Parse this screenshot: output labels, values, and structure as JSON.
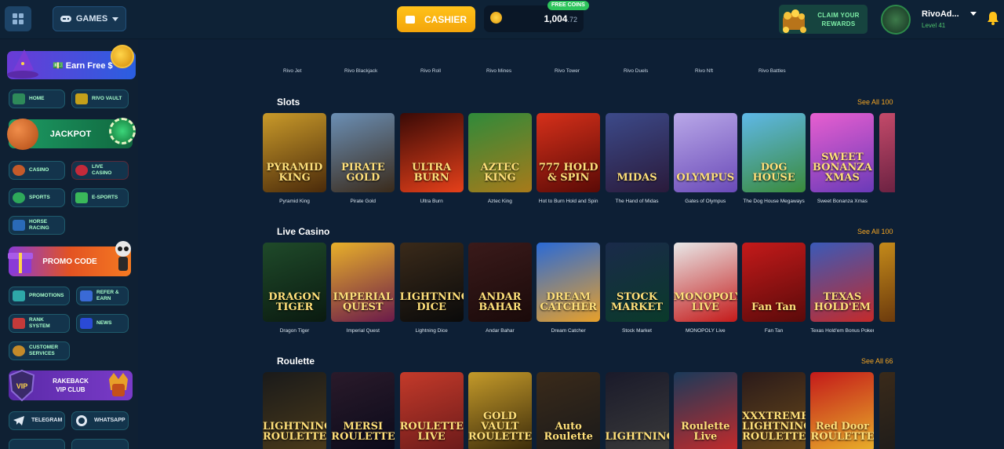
{
  "topbar": {
    "games_label": "GAMES",
    "cashier_label": "CASHIER",
    "free_coins_label": "FREE COINS",
    "balance_main": "1,004",
    "balance_decimal": ".72",
    "claim_label_line1": "CLAIM YOUR",
    "claim_label_line2": "REWARDS",
    "username": "RivoAd...",
    "level": "Level 41"
  },
  "sidebar": {
    "earn_label": "💵 Earn Free $",
    "home": "HOME",
    "rivo_vault": "RIVO VAULT",
    "jackpot": "JACKPOT",
    "casino": "CASINO",
    "live_casino_1": "LIVE",
    "live_casino_2": "CASINO",
    "sports": "SPORTS",
    "esports": "E-SPORTS",
    "horse_1": "HORSE",
    "horse_2": "RACING",
    "promo_code": "PROMO CODE",
    "promotions": "PROMOTIONS",
    "refer_1": "REFER &",
    "refer_2": "EARN",
    "rank_1": "RANK",
    "rank_2": "SYSTEM",
    "news": "NEWS",
    "cs_1": "CUSTOMER",
    "cs_2": "SERVICES",
    "vip_1": "RAKEBACK",
    "vip_2": "VIP CLUB",
    "telegram": "Telegram",
    "whatsapp": "WhatsAPP"
  },
  "top_links": [
    "Rivo Jet",
    "Rivo Blackjack",
    "Rivo Roll",
    "Rivo Mines",
    "Rivo Tower",
    "Rivo Duels",
    "Rivo Nft",
    "Rivo Battles"
  ],
  "sections": {
    "slots": {
      "title": "Slots",
      "see_all": "See All 100",
      "games": [
        {
          "name": "Pyramid King",
          "art": "PYRAMID KING",
          "c1": "#c99a2a",
          "c2": "#4a2a0a"
        },
        {
          "name": "Pirate Gold",
          "art": "PIRATE GOLD",
          "c1": "#6b8fb5",
          "c2": "#3a2a1a"
        },
        {
          "name": "Ultra Burn",
          "art": "ULTRA BURN",
          "c1": "#3a0a06",
          "c2": "#e6401a"
        },
        {
          "name": "Aztec King",
          "art": "AZTEC KING",
          "c1": "#2f8a3a",
          "c2": "#a87a1a"
        },
        {
          "name": "Hot to Burn Hold and Spin",
          "art": "777 HOLD & SPIN",
          "c1": "#d6301a",
          "c2": "#5a0a06"
        },
        {
          "name": "The Hand of Midas",
          "art": "MIDAS",
          "c1": "#3c4a8a",
          "c2": "#2a1a3a"
        },
        {
          "name": "Gates of Olympus",
          "art": "OLYMPUS",
          "c1": "#b9a8e8",
          "c2": "#6a4ab8"
        },
        {
          "name": "The Dog House Megaways",
          "art": "DOG HOUSE",
          "c1": "#5fb8e8",
          "c2": "#3a8a3a"
        },
        {
          "name": "Sweet Bonanza Xmas",
          "art": "SWEET BONANZA XMAS",
          "c1": "#e85fd0",
          "c2": "#6a3ab8"
        },
        {
          "name": "Th",
          "art": "",
          "c1": "#c44a6a",
          "c2": "#5a1a3a"
        }
      ]
    },
    "live": {
      "title": "Live Casino",
      "see_all": "See All 100",
      "games": [
        {
          "name": "Dragon Tiger",
          "art": "DRAGON TIGER",
          "c1": "#1f4a2a",
          "c2": "#0a1a10"
        },
        {
          "name": "Imperial Quest",
          "art": "IMPERIAL QUEST",
          "c1": "#e8b02a",
          "c2": "#6a1a4a"
        },
        {
          "name": "Lightning Dice",
          "art": "LIGHTNING DICE",
          "c1": "#3a2a1a",
          "c2": "#0a0a0a"
        },
        {
          "name": "Andar Bahar",
          "art": "ANDAR BAHAR",
          "c1": "#3a1a1a",
          "c2": "#1a0a0a"
        },
        {
          "name": "Dream Catcher",
          "art": "DREAM CATCHER",
          "c1": "#2a6ad6",
          "c2": "#e8a02a"
        },
        {
          "name": "Stock Market",
          "art": "STOCK MARKET",
          "c1": "#1a2a4a",
          "c2": "#0a3a2a"
        },
        {
          "name": "MONOPOLY Live",
          "art": "MONOPOLY LIVE",
          "c1": "#e8e8e8",
          "c2": "#c41a1a"
        },
        {
          "name": "Fan Tan",
          "art": "Fan Tan",
          "c1": "#c41a1a",
          "c2": "#5a0a0a"
        },
        {
          "name": "Texas Hold'em Bonus Poker",
          "art": "TEXAS HOLD'EM",
          "c1": "#3a5ab8",
          "c2": "#c42a2a"
        },
        {
          "name": "",
          "art": "",
          "c1": "#c48a1a",
          "c2": "#5a2a0a"
        }
      ]
    },
    "roulette": {
      "title": "Roulette",
      "see_all": "See All 66",
      "games": [
        {
          "name": "",
          "art": "LIGHTNING ROULETTE",
          "c1": "#1a1a1a",
          "c2": "#4a3a1a"
        },
        {
          "name": "",
          "art": "MERSI ROULETTE",
          "c1": "#2a1a2a",
          "c2": "#0a0a1a"
        },
        {
          "name": "",
          "art": "ROULETTE LIVE",
          "c1": "#c43a2a",
          "c2": "#6a1a1a"
        },
        {
          "name": "",
          "art": "GOLD VAULT ROULETTE",
          "c1": "#c49a2a",
          "c2": "#3a2a0a"
        },
        {
          "name": "",
          "art": "Auto Roulette",
          "c1": "#3a2a1a",
          "c2": "#1a1a1a"
        },
        {
          "name": "",
          "art": "LIGHTNING",
          "c1": "#1a1a2a",
          "c2": "#3a3a3a"
        },
        {
          "name": "",
          "art": "Roulette Live",
          "c1": "#1a3a5a",
          "c2": "#c42a2a"
        },
        {
          "name": "",
          "art": "XXXTREME LIGHTNING ROULETTE",
          "c1": "#2a1a1a",
          "c2": "#6a4a1a"
        },
        {
          "name": "",
          "art": "Red Door ROULETTE",
          "c1": "#c41a1a",
          "c2": "#e8b02a"
        },
        {
          "name": "",
          "art": "",
          "c1": "#3a2a1a",
          "c2": "#1a1a1a"
        }
      ]
    }
  },
  "colors": {
    "accent": "#f5a623",
    "sidebar_bg": "#0f2033",
    "main_bg": "#0d1f35"
  }
}
